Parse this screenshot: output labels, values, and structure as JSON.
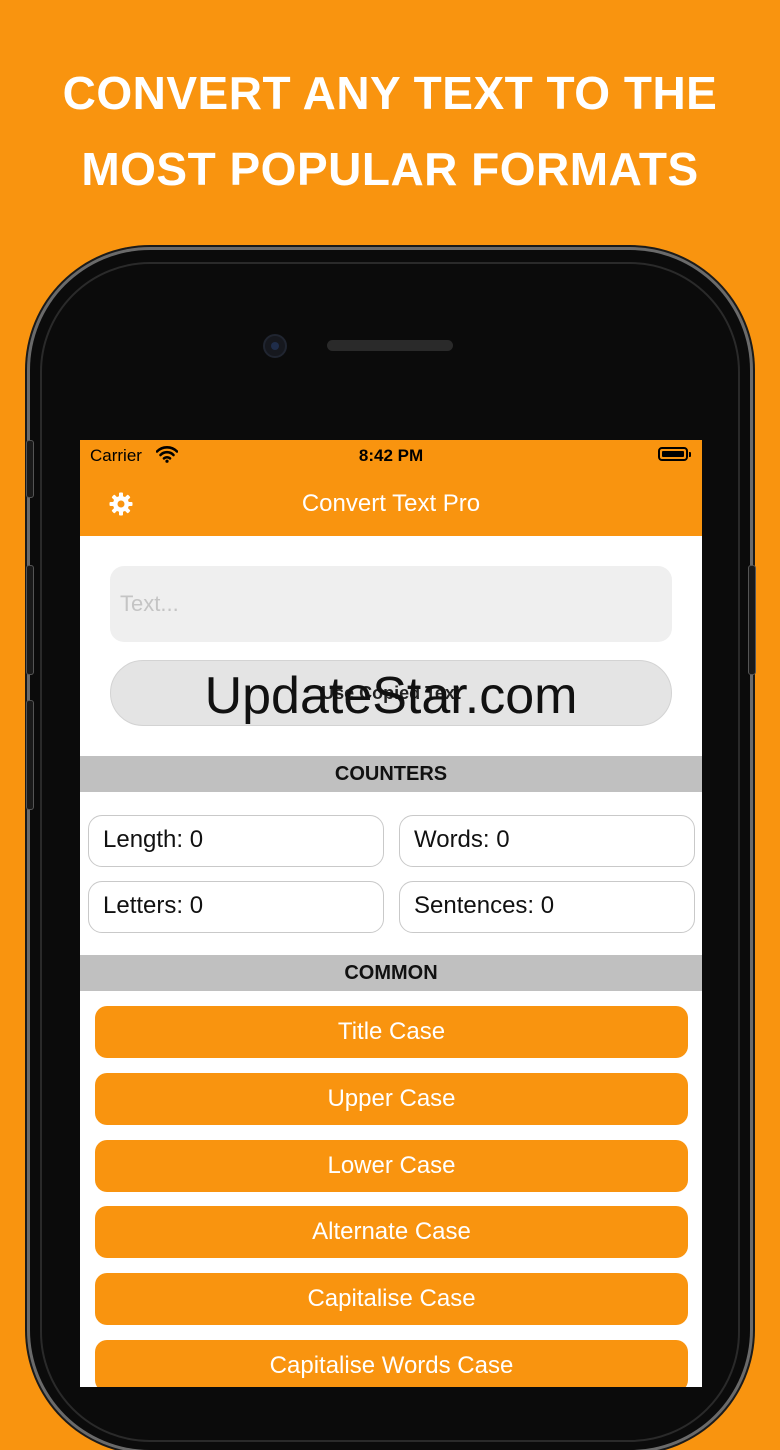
{
  "headline": {
    "line1": "CONVERT ANY TEXT TO THE",
    "line2": "MOST POPULAR FORMATS"
  },
  "status_bar": {
    "carrier": "Carrier",
    "time": "8:42 PM"
  },
  "nav": {
    "title": "Convert Text Pro",
    "settings_icon": "gear-icon"
  },
  "input": {
    "placeholder": "Text...",
    "value": ""
  },
  "use_copied_label": "Use Copied Text",
  "watermark": "UpdateStar.com",
  "counters": {
    "header": "COUNTERS",
    "length": "Length: 0",
    "words": "Words: 0",
    "letters": "Letters: 0",
    "sentences": "Sentences: 0"
  },
  "common": {
    "header": "COMMON",
    "buttons": [
      "Title Case",
      "Upper Case",
      "Lower Case",
      "Alternate Case",
      "Capitalise Case",
      "Capitalise Words Case"
    ]
  },
  "colors": {
    "accent": "#f9940f",
    "section_header": "#c0c0c0"
  }
}
